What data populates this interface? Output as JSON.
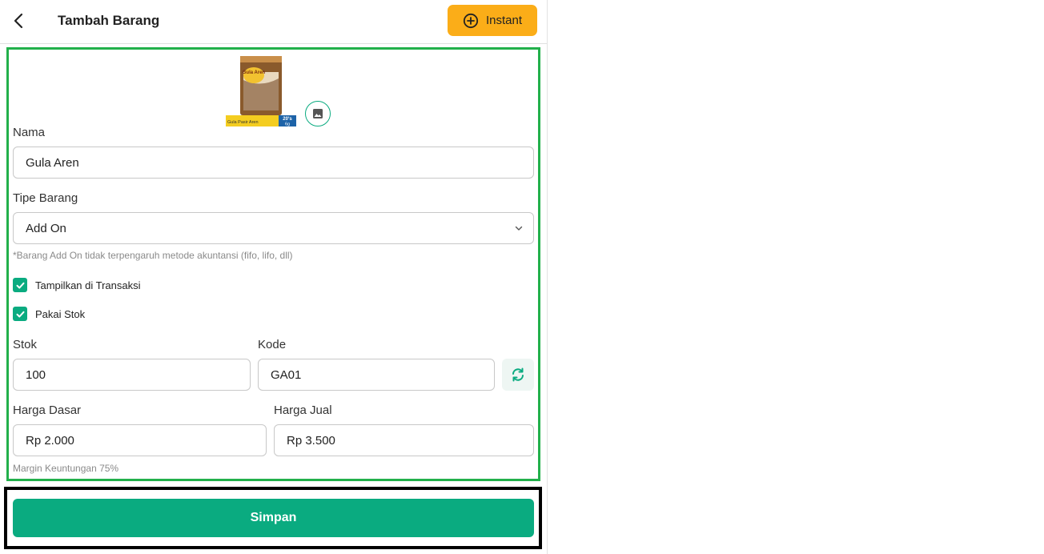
{
  "header": {
    "title": "Tambah Barang",
    "instant_label": "Instant"
  },
  "product": {
    "image_brand": "Gula Aren",
    "image_caption": "Gula Pasir Aren",
    "image_badge_top": "20's",
    "image_badge_bottom": "6g"
  },
  "form": {
    "name_label": "Nama",
    "name_value": "Gula Aren",
    "type_label": "Tipe Barang",
    "type_value": "Add On",
    "type_note": "*Barang Add On tidak terpengaruh metode akuntansi (fifo, lifo, dll)",
    "show_in_transaction_label": "Tampilkan di Transaksi",
    "show_in_transaction_checked": true,
    "use_stock_label": "Pakai Stok",
    "use_stock_checked": true,
    "stock_label": "Stok",
    "stock_value": "100",
    "code_label": "Kode",
    "code_value": "GA01",
    "base_price_label": "Harga Dasar",
    "base_price_value": "Rp 2.000",
    "sell_price_label": "Harga Jual",
    "sell_price_value": "Rp 3.500",
    "margin_text": "Margin Keuntungan 75%"
  },
  "footer": {
    "save_label": "Simpan"
  },
  "colors": {
    "accent": "#0aab80",
    "instant_button": "#fbad18",
    "highlight_border": "#22b04b"
  },
  "icons": {
    "back": "chevron-left-icon",
    "instant": "plus-circle-icon",
    "image_edit": "image-icon",
    "dropdown": "chevron-down-icon",
    "checkbox": "check-icon",
    "refresh": "refresh-icon"
  }
}
